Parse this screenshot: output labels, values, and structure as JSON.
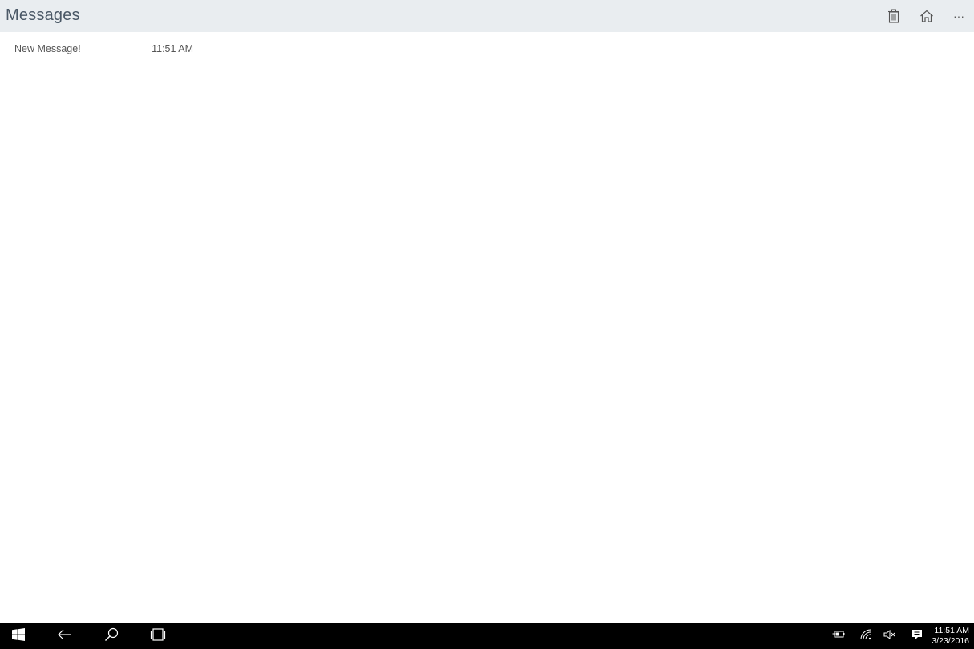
{
  "header": {
    "title": "Messages",
    "actions": [
      {
        "icon": "trash-icon",
        "label": "Delete"
      },
      {
        "icon": "home-icon",
        "label": "Home"
      },
      {
        "icon": "more-icon",
        "label": "More"
      }
    ],
    "more_glyph": "···"
  },
  "messages": [
    {
      "title": "New Message!",
      "time": "11:51 AM"
    }
  ],
  "taskbar": {
    "icons": [
      "windows-start-icon",
      "back-arrow-icon",
      "search-icon",
      "task-view-icon"
    ],
    "tray": [
      "battery-icon",
      "wifi-icon",
      "volume-muted-icon",
      "action-center-icon"
    ],
    "time": "11:51 AM",
    "date": "3/23/2016"
  },
  "colors": {
    "header_bg": "#e9edf0",
    "title_text": "#4a5866",
    "taskbar_bg": "#000000"
  }
}
